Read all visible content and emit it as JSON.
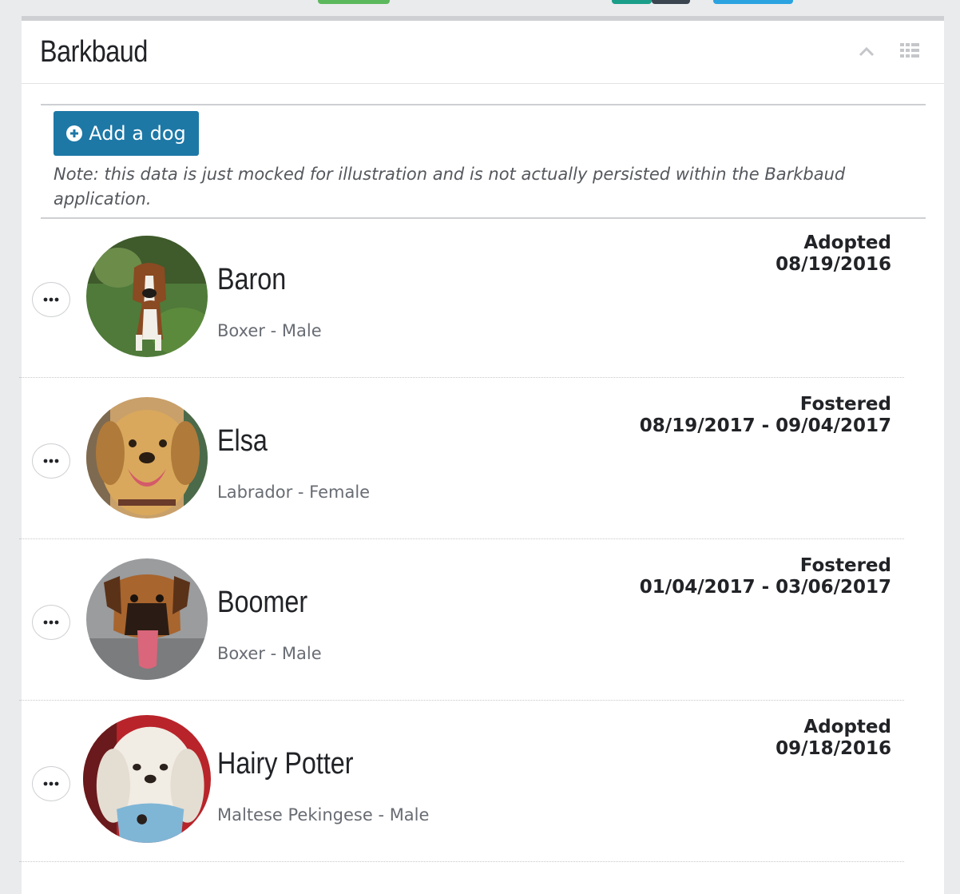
{
  "tile": {
    "title": "Barkbaud"
  },
  "toolbar": {
    "add_label": "Add a dog",
    "note": "Note: this data is just mocked for illustration and is not actually persisted within the Barkbaud application."
  },
  "icons": {
    "collapse": "chevron-up-icon",
    "move": "grid-icon",
    "add": "plus-circle-icon",
    "context_menu": "ellipsis-icon"
  },
  "colors": {
    "primary_button": "#1d78a6",
    "tab_green": "#5cb85c",
    "tab_teal": "#1a9e8a",
    "tab_dark": "#3a4550",
    "tab_blue": "#2ba3e0"
  },
  "dogs": [
    {
      "name": "Baron",
      "breed": "Boxer - Male",
      "status": "Adopted",
      "dates": "08/19/2016"
    },
    {
      "name": "Elsa",
      "breed": "Labrador - Female",
      "status": "Fostered",
      "dates": "08/19/2017 - 09/04/2017"
    },
    {
      "name": "Boomer",
      "breed": "Boxer - Male",
      "status": "Fostered",
      "dates": "01/04/2017 - 03/06/2017"
    },
    {
      "name": "Hairy Potter",
      "breed": "Maltese Pekingese - Male",
      "status": "Adopted",
      "dates": "09/18/2016"
    }
  ]
}
